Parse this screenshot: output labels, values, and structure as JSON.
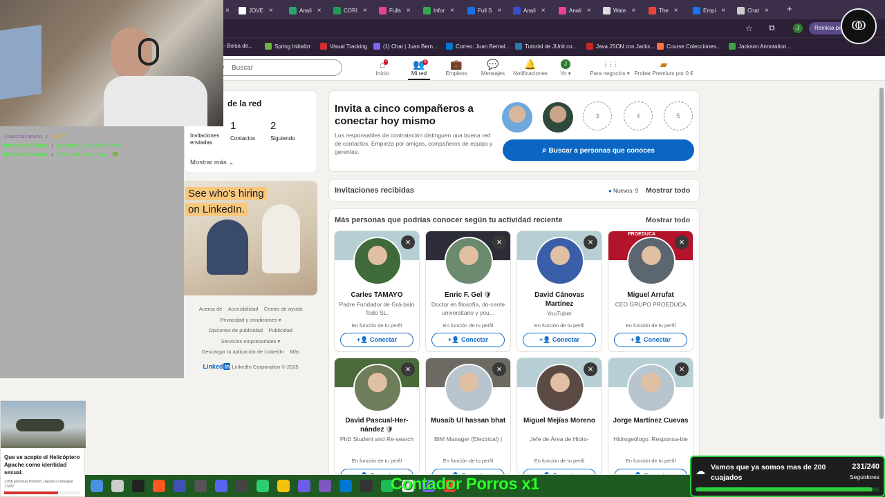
{
  "browser": {
    "tabs": [
      {
        "label": "",
        "color": "#2b2b2b"
      },
      {
        "label": "JOVE",
        "color": "#ffffff"
      },
      {
        "label": "Anali",
        "color": "#2fa36b"
      },
      {
        "label": "CORI",
        "color": "#1f9d55"
      },
      {
        "label": "Fulls",
        "color": "#e84393"
      },
      {
        "label": "Infor",
        "color": "#34a853"
      },
      {
        "label": "Full S",
        "color": "#1d6fe0"
      },
      {
        "label": "Anali",
        "color": "#3b4cca"
      },
      {
        "label": "Anali",
        "color": "#e84393"
      },
      {
        "label": "Wate",
        "color": "#dddddd"
      },
      {
        "label": "The",
        "color": "#ea4335"
      },
      {
        "label": "Empi",
        "color": "#1a73e8"
      },
      {
        "label": "Chat",
        "color": "#cccccc"
      }
    ],
    "new_tab": "+",
    "restart_label": "Reinicia par",
    "profile_initial": "J",
    "bookmarks": [
      {
        "label": "- Bolsa de...",
        "color": "#e8e2ee"
      },
      {
        "label": "Spring Initializr",
        "color": "#6db33f"
      },
      {
        "label": "Visual Tracking",
        "color": "#d32f2f"
      },
      {
        "label": "(1) Chat | Juan Bern...",
        "color": "#7b68ee"
      },
      {
        "label": "Correo: Juan Bernal...",
        "color": "#0078d4"
      },
      {
        "label": "Tutorial de JUnit co...",
        "color": "#2a7ab0"
      },
      {
        "label": "Java JSON con Jacks...",
        "color": "#c62828"
      },
      {
        "label": "Course Colecciones...",
        "color": "#ff7043"
      },
      {
        "label": "Jackson Annotation...",
        "color": "#43a047"
      }
    ]
  },
  "nav": {
    "search_placeholder": "Buscar",
    "items": [
      {
        "label": "Inicio",
        "icon": "home-icon",
        "glyph": "⌂",
        "badge": "•"
      },
      {
        "label": "Mi red",
        "icon": "network-icon",
        "glyph": "👥",
        "badge": "9"
      },
      {
        "label": "Empleos",
        "icon": "briefcase-icon",
        "glyph": "💼",
        "badge": ""
      },
      {
        "label": "Mensajes",
        "icon": "messages-icon",
        "glyph": "💬",
        "badge": ""
      },
      {
        "label": "Notificaciones",
        "icon": "bell-icon",
        "glyph": "🔔",
        "badge": ""
      },
      {
        "label": "Yo ▾",
        "icon": "avatar-icon",
        "glyph": "J",
        "badge": ""
      },
      {
        "label": "Para negocios ▾",
        "icon": "grid-icon",
        "glyph": "⋮⋮⋮",
        "badge": ""
      },
      {
        "label": "Probar Premium por 0 €",
        "icon": "premium-icon",
        "glyph": "▰",
        "badge": ""
      }
    ]
  },
  "overlay": {
    "chat": [
      {
        "user": "JuanitoCanuto",
        "msg": "ssddf",
        "user_color": "#8e44ad",
        "msg_color": "#f39c12"
      },
      {
        "user": "NecroCaticGames",
        "msg": "gaiddann_itLaudC47Hyca",
        "user_color": "#27ff1c",
        "msg_color": "#27ff1c"
      },
      {
        "user": "NecroCaticGames",
        "msg": "Have one best day! 💚",
        "user_color": "#27ff1c",
        "msg_color": "#27ff1c"
      }
    ],
    "counter": "Contador Porros x1",
    "goal": {
      "text": "Vamos que ya somos mas de 200 cuajados",
      "count": "231/240",
      "sub": "Seguidores",
      "progress": 0.9625
    },
    "news": {
      "headline": "Que se acepte el Helicóptero Apache como identidad sexual.",
      "signed": "1.058 personas firmaron. ¡Ayuda a conseguir 1.500!",
      "progress": 0.705
    }
  },
  "left": {
    "network_title": "de la red",
    "stats": [
      {
        "value": "",
        "label": "Invitaciones enviadas"
      },
      {
        "value": "1",
        "label": "Contactos"
      },
      {
        "value": "2",
        "label": "Siguiendo"
      }
    ],
    "show_more": "Mostrar más",
    "ad": {
      "line1": "See who's hiring",
      "line2": "on LinkedIn."
    },
    "footer": {
      "links": [
        "Acerca de",
        "Accesibilidad",
        "Centro de ayuda",
        "Privacidad y condiciones ▾",
        "Opciones de publicidad",
        "Publicidad",
        "Servicios empresariales ▾",
        "Descargar la aplicación de LinkedIn",
        "Más"
      ],
      "brand": "Linked",
      "brand_in": "in",
      "copyright": "LinkedIn Corporation © 2025"
    }
  },
  "invite": {
    "title": "Invita a cinco compañeros a conectar hoy mismo",
    "body": "Los responsables de contratación distinguen una buena red de contactos. Empieza por amigos, compañeros de equipo y gerentes.",
    "slots": [
      "3",
      "4",
      "5"
    ],
    "button": "Buscar a personas que conoces"
  },
  "invitations": {
    "title": "Invitaciones recibidas",
    "new_label": "Nuevos: 9",
    "show_all": "Mostrar todo"
  },
  "suggestions": {
    "title": "Más personas que podrías conocer según tu actividad reciente",
    "show_all": "Mostrar todo",
    "reason": "En función de tu perfil",
    "connect": "Conectar",
    "people": [
      {
        "name": "Carles TAMAYO",
        "headline": "Padre Fundador de Grá-balo Todo SL.",
        "cover": "#b6cfd4",
        "avatar": "#3f6b3a",
        "verified": false
      },
      {
        "name": "Enric F. Gel",
        "headline": "Doctor en filosofía, do-cente universitario y you...",
        "cover": "#2d2d3a",
        "avatar": "#6b8a6e",
        "verified": true
      },
      {
        "name": "David Cánovas Martínez",
        "headline": "YouTuber",
        "cover": "#b6cfd4",
        "avatar": "#3b5ea8",
        "verified": false
      },
      {
        "name": "Miguel Arrufat",
        "headline": "CEO GRUPO PROEDUCA",
        "cover": "#b3132b",
        "avatar": "#5b6670",
        "verified": false,
        "cover_text": "PROEDUCA"
      },
      {
        "name": "David Pascual-Her-nández",
        "headline": "PhD Student and Re-search Assistant @ URJC...",
        "cover": "#4a6a3a",
        "avatar": "#6f7d5a",
        "verified": true
      },
      {
        "name": "Musaib Ul hassan bhat",
        "headline": "BIM Manager (Electrical) | Electrical Design Engine...",
        "cover": "#6d6a63",
        "avatar": "#b9c5ce",
        "verified": false
      },
      {
        "name": "Miguel Mejías Moreno",
        "headline": "Jefe de Área de Hidro-geología Aplicada en Ins...",
        "cover": "#b6cfd4",
        "avatar": "#5b4a43",
        "verified": false
      },
      {
        "name": "Jorge Martínez Cuevas",
        "headline": "Hidrogeólogo. Responsa-ble de Actuaciones y Pr...",
        "cover": "#b6cfd4",
        "avatar": "#b9c5ce",
        "verified": false
      }
    ]
  }
}
